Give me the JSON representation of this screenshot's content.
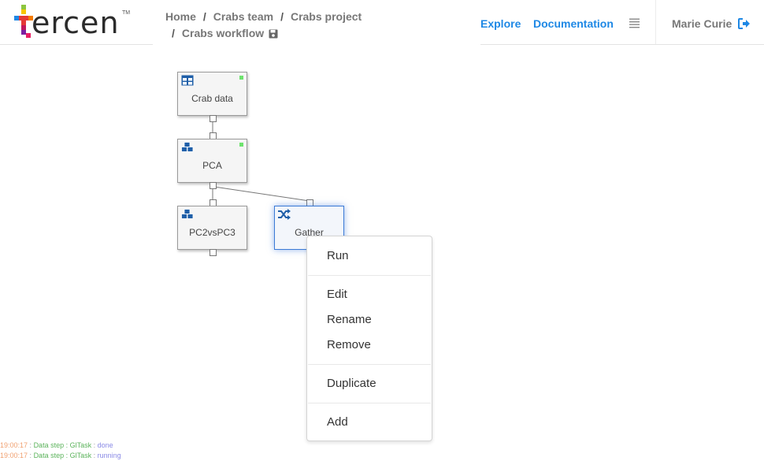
{
  "logo": {
    "text": "ercen",
    "tm": "TM"
  },
  "breadcrumb": {
    "items": [
      "Home",
      "Crabs team",
      "Crabs project"
    ],
    "separator": "/",
    "current": "Crabs workflow"
  },
  "nav": {
    "explore": "Explore",
    "documentation": "Documentation",
    "user": "Marie Curie"
  },
  "workflow": {
    "nodes": [
      {
        "label": "Crab data",
        "icon": "table-icon",
        "status": "done"
      },
      {
        "label": "PCA",
        "icon": "cubes-icon",
        "status": "done"
      },
      {
        "label": "PC2vsPC3",
        "icon": "cubes-icon",
        "status": ""
      },
      {
        "label": "Gather",
        "icon": "shuffle-icon",
        "status": "",
        "selected": true
      }
    ]
  },
  "context_menu": {
    "items": [
      "Run",
      "Edit",
      "Rename",
      "Remove",
      "Duplicate",
      "Add"
    ]
  },
  "log": [
    {
      "time": "19:00:17",
      "step": "Data step : GlTask",
      "status": "done"
    },
    {
      "time": "19:00:17",
      "step": "Data step : GlTask",
      "status": "running"
    }
  ],
  "colors": {
    "accent": "#1e88e5",
    "status_done": "#6ee36e",
    "icon_blue": "#1f5fa8",
    "selected_border": "#3b7ad6"
  }
}
